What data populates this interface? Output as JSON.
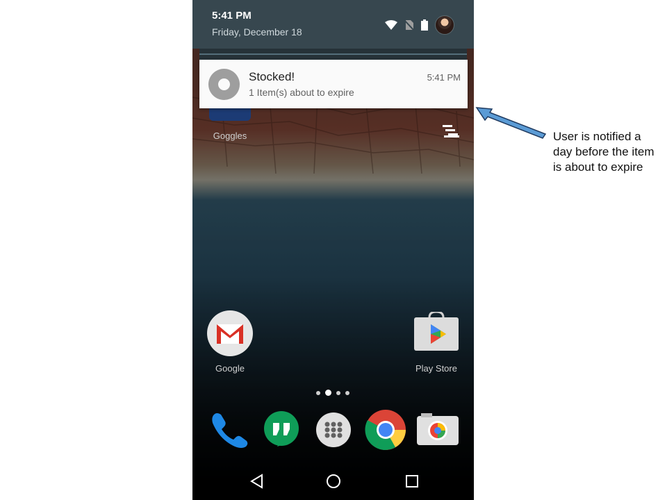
{
  "status": {
    "time": "5:41 PM",
    "date": "Friday, December 18",
    "icons": [
      "wifi-icon",
      "no-sim-icon",
      "battery-icon",
      "avatar"
    ]
  },
  "notification": {
    "title": "Stocked!",
    "body": "1 Item(s) about to expire",
    "time": "5:41 PM",
    "icon": "app-ring-icon"
  },
  "home": {
    "apps": [
      {
        "label": "Goggles",
        "icon": "goggles-icon"
      },
      {
        "label": "Google",
        "icon": "gmail-icon"
      },
      {
        "label": "Play Store",
        "icon": "play-store-icon"
      }
    ],
    "page_indicator": {
      "count": 4,
      "active": 1
    },
    "dock": [
      "phone-icon",
      "hangouts-icon",
      "app-drawer-icon",
      "chrome-icon",
      "camera-icon"
    ],
    "nav": [
      "back-icon",
      "home-icon",
      "recents-icon"
    ]
  },
  "annotation": {
    "text": "User is notified a day before the item is about to expire"
  },
  "colors": {
    "status_bar": "#37474f",
    "notification_bg": "#fafafa",
    "arrow": "#5b9bd5"
  }
}
